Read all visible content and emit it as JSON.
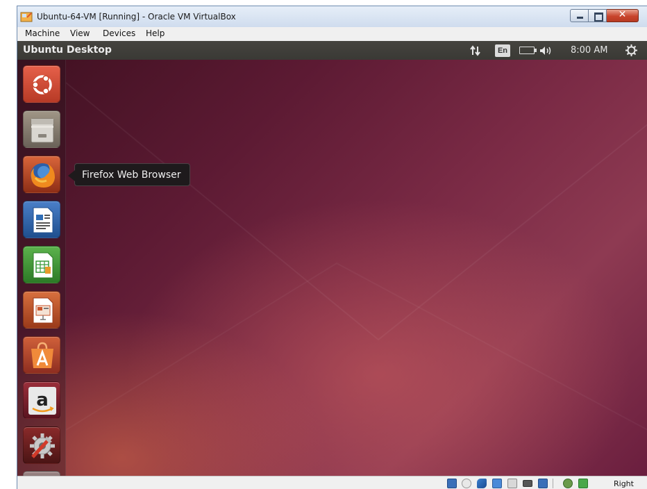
{
  "window": {
    "title": "Ubuntu-64-VM [Running] - Oracle VM VirtualBox"
  },
  "menubar": {
    "items": [
      "Machine",
      "View",
      "Devices",
      "Help"
    ]
  },
  "ubuntu": {
    "panel_title": "Ubuntu Desktop",
    "language": "En",
    "clock": "8:00 AM",
    "tooltip": "Firefox Web Browser",
    "launcher_items": [
      {
        "icon": "dash-home-icon",
        "color": "#d8563a"
      },
      {
        "icon": "files-icon",
        "color": "#8a8278"
      },
      {
        "icon": "firefox-icon",
        "color": "#d94f1f"
      },
      {
        "icon": "writer-icon",
        "color": "#2f6db5"
      },
      {
        "icon": "calc-icon",
        "color": "#3a9a3a"
      },
      {
        "icon": "impress-icon",
        "color": "#c9542c"
      },
      {
        "icon": "software-center-icon",
        "color": "#e0702a"
      },
      {
        "icon": "amazon-icon",
        "color": "#dddddd"
      },
      {
        "icon": "system-settings-icon",
        "color": "#9a2b2b"
      }
    ]
  },
  "statusbar": {
    "host_key": "Right Ctrl",
    "icons": [
      "hard-disk-icon",
      "optical-drive-icon",
      "usb-icon",
      "network-icon",
      "shared-folders-icon",
      "display-icon",
      "video-capture-icon",
      "virtualization-icon",
      "mouse-integration-icon"
    ]
  },
  "colors": {
    "panel": "#3c3b37",
    "tooltip_bg": "#1e1a1c",
    "desktop_dark": "#4a1428",
    "desktop_accent": "#c85a5a"
  }
}
